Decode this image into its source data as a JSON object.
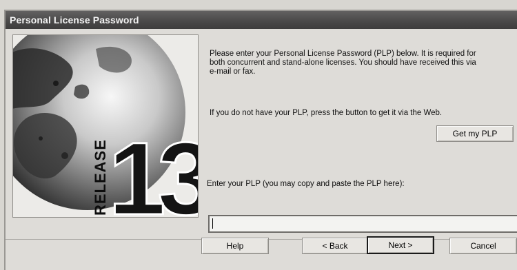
{
  "window": {
    "title": "Personal License Password"
  },
  "artwork": {
    "release_word": "RELEASE",
    "release_number": "13"
  },
  "instructions": {
    "line1": "Please enter your Personal License Password (PLP) below.  It is required for",
    "line2": "both concurrent and stand-alone licenses.  You should have received this via",
    "line3": "e-mail or fax."
  },
  "web_prompt": "If you do not have your PLP, press the button to get it via the Web.",
  "get_plp_button": "Get my PLP",
  "plp_label": "Enter your PLP (you may copy and paste the PLP here):",
  "plp_input": {
    "value": "",
    "placeholder": ""
  },
  "buttons": {
    "help": "Help",
    "back": "< Back",
    "next": "Next >",
    "cancel": "Cancel"
  }
}
